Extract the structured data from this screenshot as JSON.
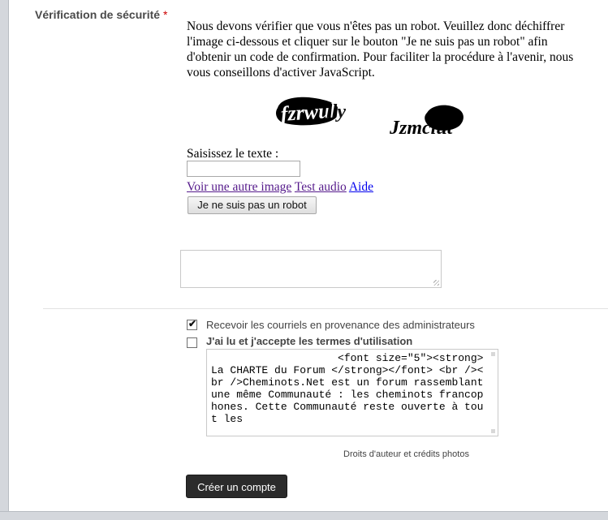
{
  "security": {
    "label": "Vérification de sécurité",
    "required_marker": "*",
    "intro_text": "Nous devons vérifier que vous n'êtes pas un robot. Veuillez donc déchiffrer l'image ci-dessous et cliquer sur le bouton \"Je ne suis pas un robot\" afin d'obtenir un code de confirmation. Pour faciliter la procédure à l'avenir, nous vous conseillons d'activer JavaScript.",
    "captcha_words": [
      "fzrwully",
      "Jzmclut"
    ],
    "enter_text_label": "Saisissez le texte :",
    "input_value": "",
    "links": {
      "another_image": "Voir une autre image",
      "audio": "Test audio",
      "help": "Aide"
    },
    "robot_button": "Je ne suis pas un robot"
  },
  "options": {
    "emails_checkbox": {
      "label": "Recevoir les courriels en provenance des administrateurs",
      "checked": true
    },
    "terms_checkbox": {
      "label": "J'ai lu et j'accepte les termes d'utilisation",
      "checked": false
    },
    "terms_text": "                    <font size=\"5\"><strong>La CHARTE du Forum </strong></font> <br /><br />Cheminots.Net est un forum rassemblant une même Communauté : les cheminots francophones. Cette Communauté reste ouverte à tout les"
  },
  "footer": {
    "credits": "Droits d'auteur et crédits photos",
    "create_button": "Créer un compte"
  },
  "colors": {
    "frame": "#d4d7dc",
    "label_gray": "#4a4a4a",
    "required_red": "#cc0000",
    "button_dark": "#2b2b2b",
    "link_visited": "#551a8b",
    "link": "#0000ee"
  }
}
